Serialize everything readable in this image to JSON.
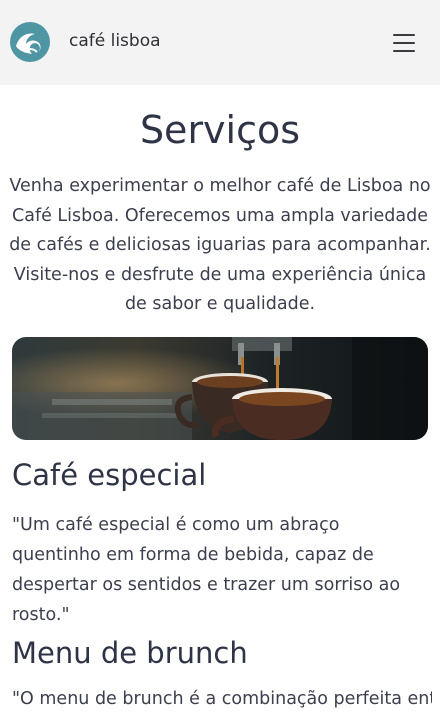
{
  "header": {
    "logo_icon": "wave-logo-icon",
    "brand": "café lisboa",
    "menu_icon": "hamburger-menu-icon"
  },
  "main": {
    "title": "Serviços",
    "intro": "Venha experimentar o melhor café de Lisboa no Café Lisboa. Oferecemos uma ampla variedade de cafés e deliciosas iguarias para acompanhar. Visite-nos e desfrute de uma experiência única de sabor e qualidade.",
    "sections": [
      {
        "title": "Café especial",
        "text": "\"Um café especial é como um abraço quentinho em forma de bebida, capaz de despertar os sentidos e trazer um sorriso ao rosto.\""
      },
      {
        "title": "Menu de brunch",
        "text": "\"O menu de brunch é a combinação perfeita entre"
      }
    ]
  },
  "colors": {
    "header_bg": "#f3f3f4",
    "logo_teal": "#4e96a3",
    "heading": "#2f3346",
    "body_text": "#3c3f4d"
  }
}
